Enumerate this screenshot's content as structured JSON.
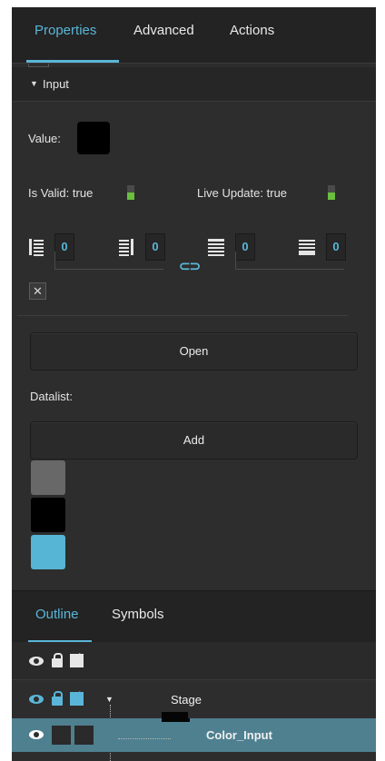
{
  "tabs": {
    "properties": "Properties",
    "advanced": "Advanced",
    "actions": "Actions"
  },
  "section": {
    "title": "Input"
  },
  "fields": {
    "value_label": "Value:",
    "value_color": "#000000",
    "is_valid_label": "Is Valid:",
    "is_valid_value": "true",
    "live_update_label": "Live Update:",
    "live_update_value": "true"
  },
  "padding": {
    "left": "0",
    "right": "0",
    "top": "0",
    "bottom": "0"
  },
  "buttons": {
    "open": "Open",
    "add": "Add"
  },
  "datalist": {
    "label": "Datalist:",
    "colors": [
      "#686868",
      "#000000",
      "#56b4d4"
    ]
  },
  "outline": {
    "tabs": {
      "outline": "Outline",
      "symbols": "Symbols"
    },
    "tree": [
      {
        "label": "Stage",
        "expanded": true
      },
      {
        "label": "Color_Input",
        "selected": true
      }
    ]
  },
  "colors": {
    "accent": "#5ab6d8",
    "valid_green": "#6abf3e",
    "selection": "#4e8090",
    "panel_bg": "#2d2d2d"
  }
}
